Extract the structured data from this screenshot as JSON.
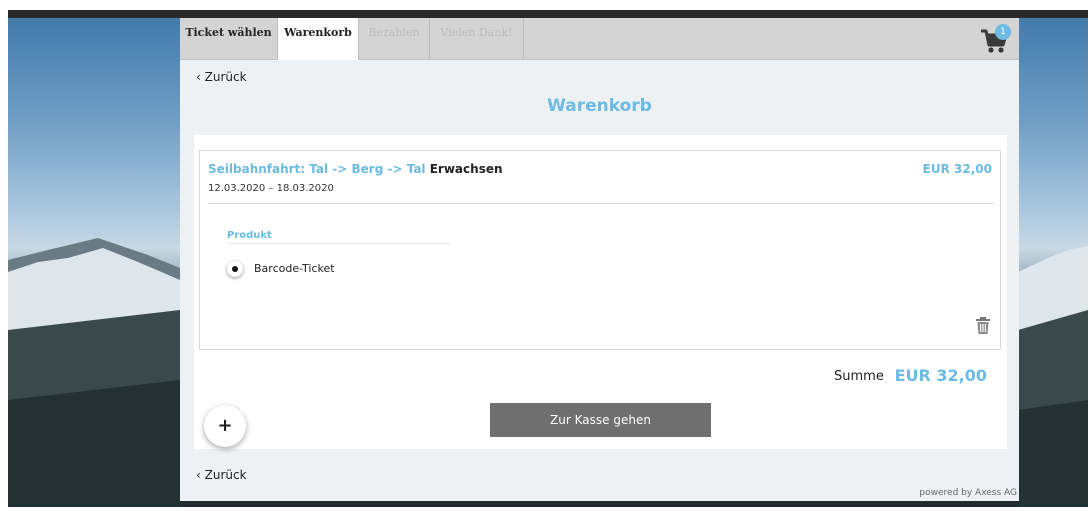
{
  "tabs": [
    {
      "label": "Ticket wählen",
      "state": "done"
    },
    {
      "label": "Warenkorb",
      "state": "active"
    },
    {
      "label": "Bezahlen",
      "state": "disabled"
    },
    {
      "label": "Vielen Dank!",
      "state": "disabled"
    }
  ],
  "cart": {
    "count": "1",
    "icon": "cart-icon"
  },
  "nav": {
    "back_top": "‹ Zurück",
    "back_bottom": "‹ Zurück"
  },
  "page_title": "Warenkorb",
  "item": {
    "name": "Seilbahnfahrt: Tal -> Berg -> Tal",
    "category": "Erwachsen",
    "price": "EUR 32,00",
    "dates": "12.03.2020 – 18.03.2020",
    "product_label": "Produkt",
    "product_option": "Barcode-Ticket",
    "delete_icon": "trash-icon"
  },
  "summary": {
    "label": "Summe",
    "value": "EUR 32,00"
  },
  "checkout_label": "Zur Kasse gehen",
  "add_label": "+",
  "footer": "powered by Axess AG",
  "colors": {
    "accent": "#6bbbe3",
    "button": "#6f6f6f"
  }
}
